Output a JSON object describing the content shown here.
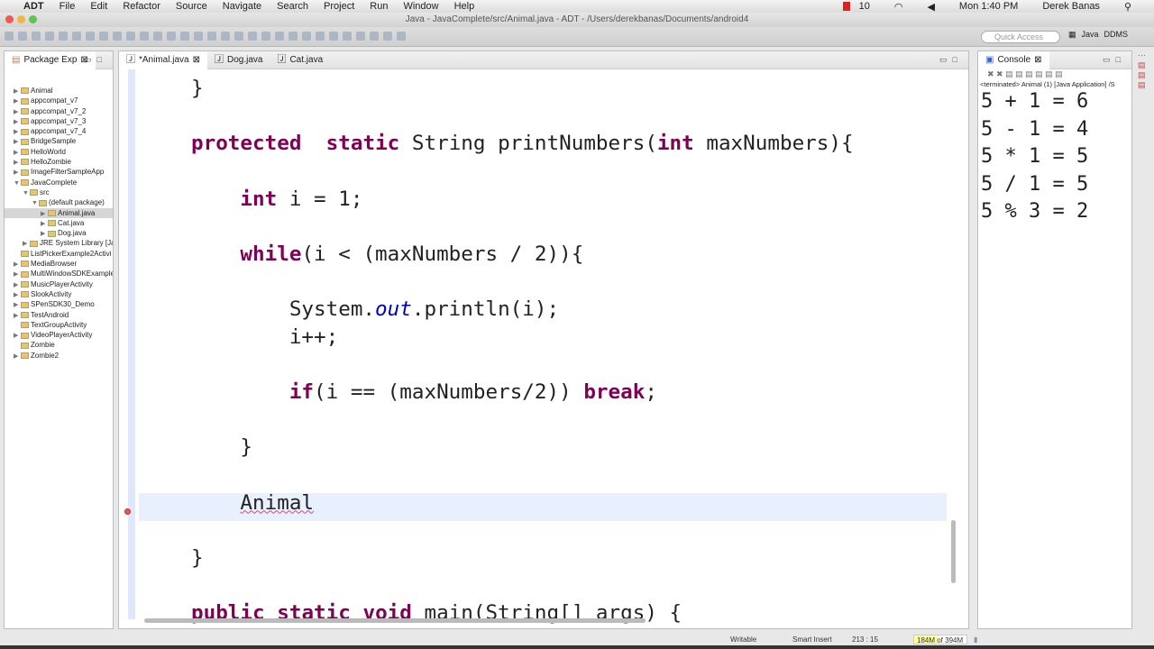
{
  "menubar": {
    "app": "ADT",
    "items": [
      "File",
      "Edit",
      "Refactor",
      "Source",
      "Navigate",
      "Search",
      "Project",
      "Run",
      "Window",
      "Help"
    ],
    "tray": {
      "notifications": "10",
      "clock": "Mon 1:40 PM",
      "user": "Derek Banas"
    }
  },
  "window": {
    "title": "Java - JavaComplete/src/Animal.java - ADT - /Users/derekbanas/Documents/android4"
  },
  "toolbar": {
    "quick_access_placeholder": "Quick Access",
    "perspectives": [
      "Java",
      "DDMS"
    ]
  },
  "package_explorer": {
    "title": "Package Exp",
    "items": [
      {
        "label": "Animal",
        "depth": 0,
        "arrow": "▶"
      },
      {
        "label": "appcompat_v7",
        "depth": 0,
        "arrow": "▶"
      },
      {
        "label": "appcompat_v7_2",
        "depth": 0,
        "arrow": "▶"
      },
      {
        "label": "appcompat_v7_3",
        "depth": 0,
        "arrow": "▶"
      },
      {
        "label": "appcompat_v7_4",
        "depth": 0,
        "arrow": "▶"
      },
      {
        "label": "BridgeSample",
        "depth": 0,
        "arrow": "▶"
      },
      {
        "label": "HelloWorld",
        "depth": 0,
        "arrow": "▶"
      },
      {
        "label": "HelloZombie",
        "depth": 0,
        "arrow": "▶"
      },
      {
        "label": "ImageFilterSampleApp",
        "depth": 0,
        "arrow": "▶"
      },
      {
        "label": "JavaComplete",
        "depth": 0,
        "arrow": "▼"
      },
      {
        "label": "src",
        "depth": 1,
        "arrow": "▼"
      },
      {
        "label": "(default package)",
        "depth": 2,
        "arrow": "▼"
      },
      {
        "label": "Animal.java",
        "depth": 3,
        "arrow": "▶",
        "selected": true
      },
      {
        "label": "Cat.java",
        "depth": 3,
        "arrow": "▶"
      },
      {
        "label": "Dog.java",
        "depth": 3,
        "arrow": "▶"
      },
      {
        "label": "JRE System Library [Ja",
        "depth": 1,
        "arrow": "▶"
      },
      {
        "label": "ListPickerExample2Activi",
        "depth": 0,
        "arrow": ""
      },
      {
        "label": "MediaBrowser",
        "depth": 0,
        "arrow": "▶"
      },
      {
        "label": "MultiWindowSDKExample",
        "depth": 0,
        "arrow": "▶"
      },
      {
        "label": "MusicPlayerActivity",
        "depth": 0,
        "arrow": "▶"
      },
      {
        "label": "SlookActivity",
        "depth": 0,
        "arrow": "▶"
      },
      {
        "label": "SPenSDK30_Demo",
        "depth": 0,
        "arrow": "▶"
      },
      {
        "label": "TestAndroid",
        "depth": 0,
        "arrow": "▶"
      },
      {
        "label": "TextGroupActivity",
        "depth": 0,
        "arrow": ""
      },
      {
        "label": "VideoPlayerActivity",
        "depth": 0,
        "arrow": "▶"
      },
      {
        "label": "Zombie",
        "depth": 0,
        "arrow": ""
      },
      {
        "label": "Zombie2",
        "depth": 0,
        "arrow": "▶"
      }
    ]
  },
  "editor": {
    "tabs": [
      "*Animal.java",
      "Dog.java",
      "Cat.java"
    ],
    "lines": [
      [
        [
          "",
          "}"
        ]
      ],
      [],
      [
        [
          "kw",
          "protected"
        ],
        [
          "",
          "  "
        ],
        [
          "kw",
          "static"
        ],
        [
          "",
          " String printNumbers("
        ],
        [
          "kw",
          "int"
        ],
        [
          "",
          " maxNumbers){"
        ]
      ],
      [],
      [
        [
          "",
          "    "
        ],
        [
          "kw",
          "int"
        ],
        [
          "",
          " i = 1;"
        ]
      ],
      [],
      [
        [
          "",
          "    "
        ],
        [
          "kw",
          "while"
        ],
        [
          "",
          "(i < (maxNumbers / 2)){"
        ]
      ],
      [],
      [
        [
          "",
          "        System."
        ],
        [
          "fld",
          "out"
        ],
        [
          "",
          ".println(i);"
        ]
      ],
      [
        [
          "",
          "        i++;"
        ]
      ],
      [],
      [
        [
          "",
          "        "
        ],
        [
          "kw",
          "if"
        ],
        [
          "",
          "(i == (maxNumbers/2)) "
        ],
        [
          "kw",
          "break"
        ],
        [
          "",
          ";"
        ]
      ],
      [],
      [
        [
          "",
          "    }"
        ]
      ],
      [],
      [
        [
          "",
          "    "
        ],
        [
          "err",
          "Animal"
        ]
      ],
      [],
      [
        [
          "",
          "}"
        ]
      ],
      [],
      [
        [
          "kw",
          "public"
        ],
        [
          "",
          " "
        ],
        [
          "kw",
          "static"
        ],
        [
          "",
          " "
        ],
        [
          "kw",
          "void"
        ],
        [
          "",
          " main(String[] args) {"
        ]
      ]
    ]
  },
  "console": {
    "title": "Console",
    "status": "<terminated> Animal (1) [Java Application] /S",
    "output": [
      "5 + 1 = 6",
      "5 - 1 = 4",
      "5 * 1 = 5",
      "5 / 1 = 5",
      "5 % 3 = 2"
    ]
  },
  "statusbar": {
    "writable": "Writable",
    "insert_mode": "Smart Insert",
    "position": "213 : 15",
    "memory": "184M of 394M",
    "memory_used_fraction": 0.467
  }
}
